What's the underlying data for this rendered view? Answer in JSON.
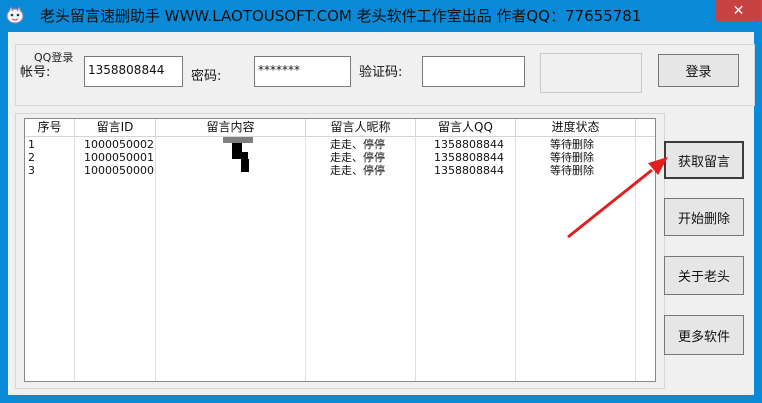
{
  "window": {
    "title": "老头留言速删助手 WWW.LAOTOUSOFT.COM 老头软件工作室出品 作者QQ：77655781",
    "close_glyph": "✕",
    "accent_color": "#0a8ad6",
    "close_color": "#c74343"
  },
  "login": {
    "group_label": "QQ登录",
    "account_label": "帐号:",
    "account_value": "1358808844",
    "password_label": "密码:",
    "password_value": "*******",
    "captcha_label": "验证码:",
    "captcha_value": "",
    "login_button": "登录"
  },
  "table": {
    "headers": [
      "序号",
      "留言ID",
      "留言内容",
      "留言人昵称",
      "留言人QQ",
      "进度状态"
    ],
    "rows": [
      {
        "index": "1",
        "id": "1000050002",
        "content": "",
        "nickname": "走走、停停",
        "qq": "1358808844",
        "status": "等待删除"
      },
      {
        "index": "2",
        "id": "1000050001",
        "content": "",
        "nickname": "走走、停停",
        "qq": "1358808844",
        "status": "等待删除"
      },
      {
        "index": "3",
        "id": "1000050000",
        "content": "",
        "nickname": "走走、停停",
        "qq": "1358808844",
        "status": "等待删除"
      }
    ]
  },
  "actions": {
    "fetch": "获取留言",
    "start_delete": "开始删除",
    "about": "关于老头",
    "more": "更多软件"
  },
  "annotation": {
    "arrow_color": "#e02020"
  }
}
